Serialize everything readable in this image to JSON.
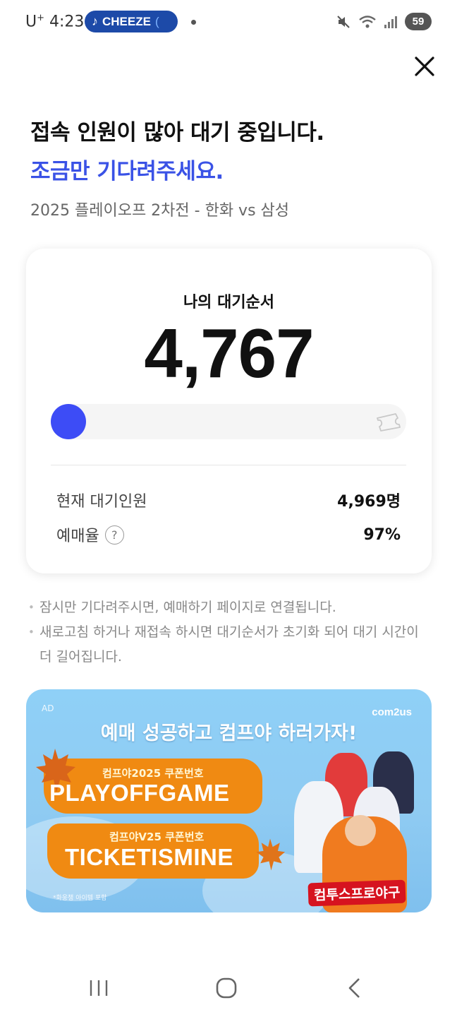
{
  "status_bar": {
    "carrier": "U",
    "carrier_sup": "+",
    "time": "4:23",
    "media_pill": "CHEEZE",
    "media_pill_tail": "(",
    "battery": "59"
  },
  "header": {
    "title_line1": "접속 인원이 많아 대기 중입니다.",
    "title_line2": "조금만 기다려주세요.",
    "game_name": "2025 플레이오프 2차전 - 한화 vs 삼성"
  },
  "queue_card": {
    "label": "나의 대기순서",
    "position": "4,767",
    "progress_fraction": 0.0,
    "rows": [
      {
        "label": "현재 대기인원",
        "value": "4,969명"
      },
      {
        "label": "예매율",
        "value": "97%",
        "help": "?"
      }
    ]
  },
  "notes": [
    "잠시만 기다려주시면, 예매하기 페이지로 연결됩니다.",
    "새로고침 하거나 재접속 하시면 대기순서가 초기화 되어 대기 시간이 더 길어집니다."
  ],
  "ad": {
    "tag": "AD",
    "brand": "com2us",
    "headline": "예매 성공하고 컴프야 하러가자!",
    "coupon1_label": "컴프야2025 쿠폰번호",
    "coupon1_code": "PLAYOFFGAME",
    "coupon2_label": "컴프야V25 쿠폰번호",
    "coupon2_code": "TICKETISMINE",
    "footnote": "*화웅챙 아이템 포함",
    "game_logo": "컴투스프로야구"
  },
  "colors": {
    "accent_blue": "#3a52e6",
    "progress_knob": "#3d4cf6",
    "ad_orange": "#f08a12"
  }
}
